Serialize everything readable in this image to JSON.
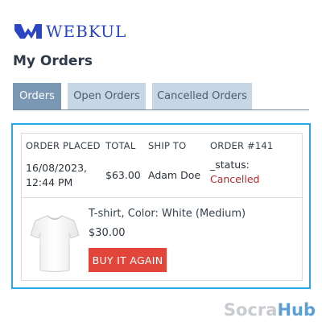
{
  "brand": {
    "logo_text": "WEBKUL",
    "logo_color": "#2a46c4"
  },
  "page": {
    "title": "My Orders"
  },
  "tabs": [
    {
      "label": "Orders",
      "active": true
    },
    {
      "label": "Open Orders",
      "active": false
    },
    {
      "label": "Cancelled Orders",
      "active": false
    }
  ],
  "order": {
    "headers": {
      "placed": "ORDER PLACED",
      "total": "TOTAL",
      "ship_to": "SHIP TO",
      "order_number": "ORDER #141"
    },
    "placed_date": "16/08/2023,",
    "placed_time": "12:44 PM",
    "total": "$63.00",
    "ship_to": "Adam Doe",
    "status_label": "_status: ",
    "status_value": "Cancelled",
    "status_color": "#b62a2a",
    "item": {
      "image_icon": "tshirt-icon",
      "name": "T-shirt, Color: White (Medium)",
      "price": "$30.00",
      "button_label": "BUY IT AGAIN",
      "button_color": "#e2463a"
    }
  },
  "watermark": {
    "part1": "Socra",
    "part2": "Hub"
  },
  "colors": {
    "tab_active": "#7a98b3",
    "tab_inactive": "#c7d6e4",
    "frame_highlight": "#2ea5e6"
  }
}
